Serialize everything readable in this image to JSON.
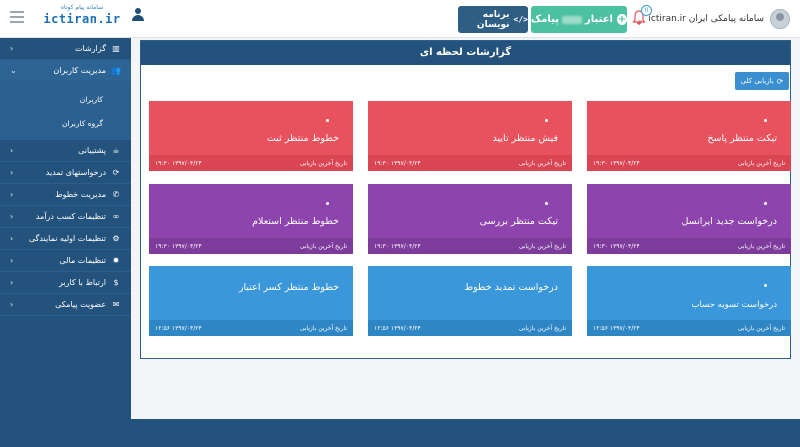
{
  "header": {
    "brand_tag": "سامانه پیام کوتاه",
    "brand_name": "ictiran.ir",
    "org_label": "سامانه پیامکی ایران ictiran.ir",
    "notification_count": "0",
    "credit_prefix": "اعتبار",
    "credit_suffix": "پیامک",
    "dev_label": "برنامه نویسان",
    "dev_icon": "</>"
  },
  "sidebar": {
    "items": [
      {
        "label": "گزارشات",
        "icon": "chart-icon"
      },
      {
        "label": "مدیریت کاربران",
        "icon": "users-icon"
      },
      {
        "label": "پشتیبانی",
        "icon": "coffee-icon"
      },
      {
        "label": "درخواستهای تمدید",
        "icon": "refresh-icon"
      },
      {
        "label": "مدیریت خطوط",
        "icon": "phone-icon"
      },
      {
        "label": "تنظیمات کسب درآمد",
        "icon": "link-icon"
      },
      {
        "label": "تنظیمات اولیه نمایندگی",
        "icon": "cogs-icon"
      },
      {
        "label": "تنظیمات مالی",
        "icon": "gear-icon"
      },
      {
        "label": "ارتباط با کاربر",
        "icon": "dollar-icon"
      },
      {
        "label": "عضویت پیامکی",
        "icon": "envelope-icon"
      }
    ],
    "sub_items": [
      "کاربران",
      "گروه کاربران"
    ]
  },
  "panel": {
    "title": "گزارشات لحظه ای",
    "refresh_label": "بازیابی کلی",
    "footer_label": "تاریخ آخرین بازیابی",
    "cards": [
      {
        "title": "تیکت منتظر پاسخ",
        "time": "۱۳۹۷/۰۴/۲۴ ۱۹:۳۰",
        "color": "red"
      },
      {
        "title": "فیش منتظر تایید",
        "time": "۱۳۹۷/۰۴/۲۴ ۱۹:۳۰",
        "color": "red"
      },
      {
        "title": "خطوط منتظر ثبت",
        "time": "۱۳۹۷/۰۴/۲۴ ۱۹:۳۰",
        "color": "red"
      },
      {
        "title": "درخواست جدید ایرانسل",
        "time": "۱۳۹۷/۰۴/۲۴ ۱۹:۳۰",
        "color": "purple"
      },
      {
        "title": "تیکت منتظر بررسی",
        "time": "۱۳۹۷/۰۴/۲۴ ۱۹:۳۰",
        "color": "purple"
      },
      {
        "title": "خطوط منتظر استعلام",
        "time": "۱۳۹۷/۰۴/۲۴ ۱۹:۳۰",
        "color": "purple"
      },
      {
        "title": "درخواست تسویه حساب",
        "time": "۱۳۹۷/۰۴/۲۴ ۱۲:۵۶",
        "color": "blue"
      },
      {
        "title": "درخواست تمدید خطوط",
        "time": "۱۳۹۷/۰۴/۲۴ ۱۲:۵۶",
        "color": "blue"
      },
      {
        "title": "خطوط منتظر کسر اعتبار",
        "time": "۱۳۹۷/۰۴/۲۴ ۱۲:۵۶",
        "color": "blue"
      }
    ]
  },
  "colors": {
    "red": "#e8525d",
    "purple": "#8e44ad",
    "blue": "#3a97d9",
    "sidebar": "#23527c",
    "credit_button": "#4cc1a2",
    "dev_button": "#2f5e84"
  }
}
